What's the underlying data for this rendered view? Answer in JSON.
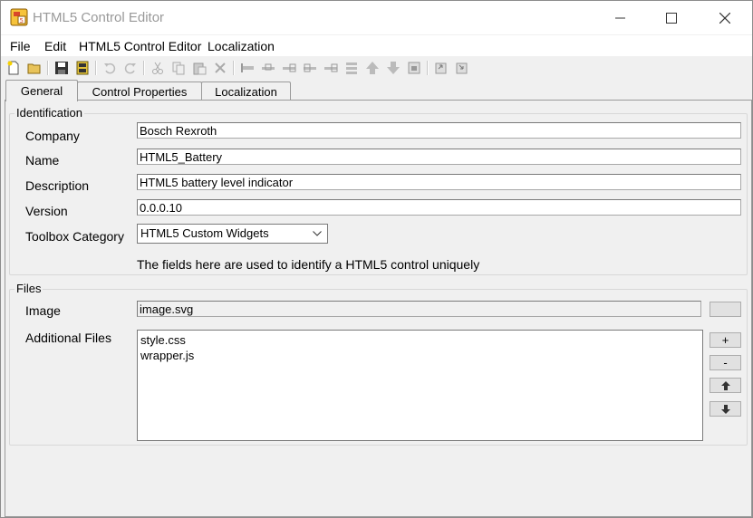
{
  "window": {
    "title": "HTML5 Control Editor",
    "minimize_icon": "minimize-icon",
    "maximize_icon": "maximize-icon",
    "close_icon": "close-icon"
  },
  "menu": [
    "File",
    "Edit",
    "HTML5 Control Editor",
    "Localization"
  ],
  "toolbar_icons": [
    "new-icon",
    "open-icon",
    "save-icon",
    "save-all-icon",
    "undo-icon",
    "redo-icon",
    "cut-icon",
    "copy-icon",
    "paste-icon",
    "delete-icon",
    "align-left-icon",
    "align-center-icon",
    "align-right-icon",
    "align-top-icon",
    "align-middle-icon",
    "align-bottom-icon",
    "move-up-icon",
    "move-down-icon",
    "properties-icon",
    "import-icon",
    "export-icon"
  ],
  "tabs": [
    "General",
    "Control Properties",
    "Localization"
  ],
  "identification": {
    "legend": "Identification",
    "company_label": "Company",
    "company_value": "Bosch Rexroth",
    "name_label": "Name",
    "name_value": "HTML5_Battery",
    "description_label": "Description",
    "description_value": "HTML5 battery level indicator",
    "version_label": "Version",
    "version_value": "0.0.0.10",
    "toolbox_label": "Toolbox Category",
    "toolbox_value": "HTML5 Custom Widgets",
    "hint": "The fields here are used to identify a HTML5 control uniquely"
  },
  "files": {
    "legend": "Files",
    "image_label": "Image",
    "image_value": "image.svg",
    "additional_label": "Additional Files",
    "additional_items": [
      "style.css",
      "wrapper.js"
    ],
    "add_label": "+",
    "remove_label": "-"
  }
}
